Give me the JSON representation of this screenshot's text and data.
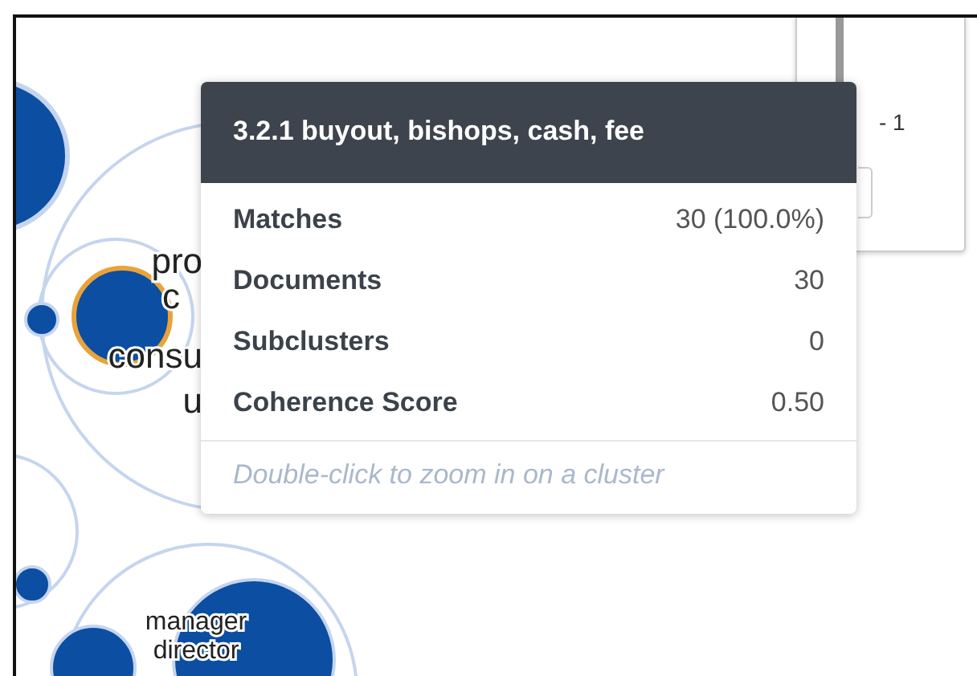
{
  "cluster_labels": [
    {
      "lines": [
        "pro"
      ]
    },
    {
      "lines": [
        "c"
      ]
    },
    {
      "lines": [
        "consu"
      ]
    },
    {
      "lines": [
        "u"
      ]
    },
    {
      "lines": [
        "manager",
        "director"
      ]
    }
  ],
  "side_panel": {
    "range_text": "- 1"
  },
  "tooltip": {
    "title": "3.2.1 buyout, bishops, cash, fee",
    "rows": [
      {
        "label": "Matches",
        "value": "30 (100.0%)"
      },
      {
        "label": "Documents",
        "value": "30"
      },
      {
        "label": "Subclusters",
        "value": "0"
      },
      {
        "label": "Coherence Score",
        "value": "0.50"
      }
    ],
    "hint": "Double-click to zoom in on a cluster"
  }
}
